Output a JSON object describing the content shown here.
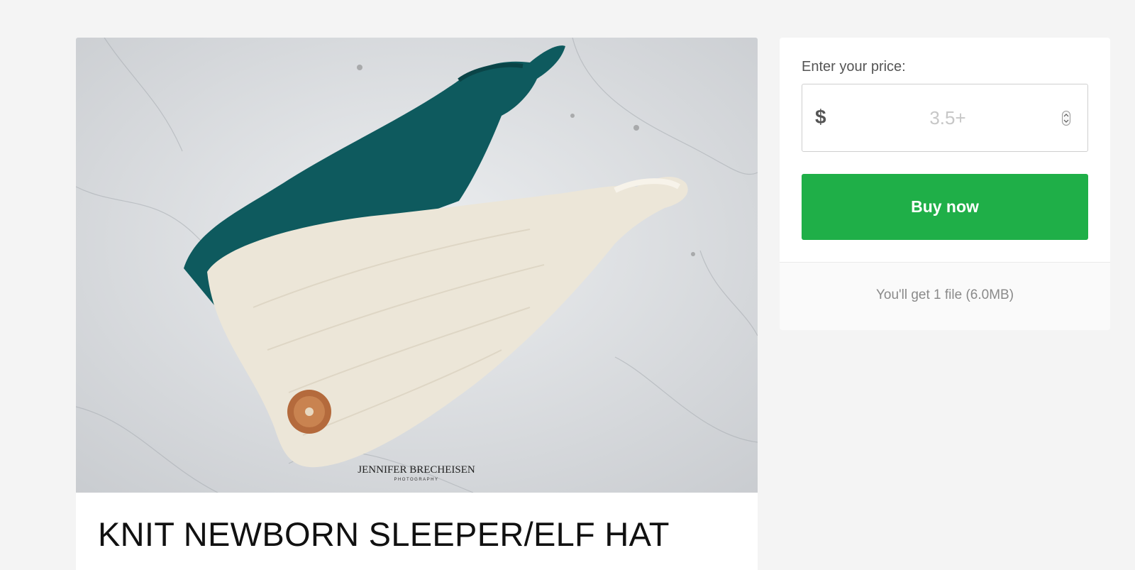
{
  "product": {
    "title": "KNIT NEWBORN SLEEPER/ELF HAT",
    "image": {
      "description_icon": "knit-hat-photo",
      "watermark_main": "JENNIFER BRECHEISEN",
      "watermark_sub": "PHOTOGRAPHY"
    }
  },
  "purchase": {
    "price_label": "Enter your price:",
    "currency_symbol": "$",
    "price_placeholder": "3.5+",
    "price_value": "",
    "buy_label": "Buy now",
    "file_info": "You'll get 1 file (6.0MB)"
  },
  "colors": {
    "page_background": "#f4f4f4",
    "buy_button": "#1faf48",
    "hat_teal": "#0e5a5e",
    "hat_cream": "#ece6d8",
    "button_copper": "#b46a3c"
  }
}
